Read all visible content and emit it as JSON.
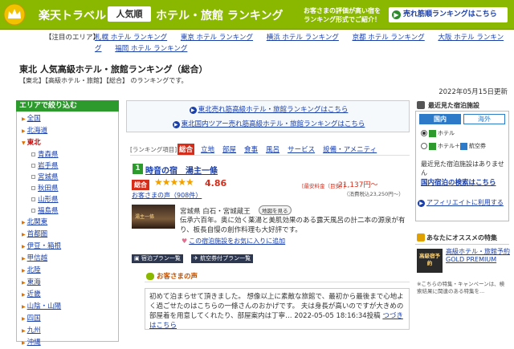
{
  "banner": {
    "title_part1": "楽天トラベル",
    "badge": "人気順",
    "title_part2": "ホテル・旅館 ランキング",
    "catch_line1": "お客さまの評価が高い宿を",
    "catch_line2": "ランキング形式でご紹介！",
    "promo_link": "売れ筋順ランキングはこちら"
  },
  "attention": {
    "label": "【注目のエリア】",
    "links": [
      "札幌 ホテル ランキング",
      "東京 ホテル ランキング",
      "横浜 ホテル ランキング",
      "京都 ホテル ランキング",
      "大阪 ホテル ランキング",
      "福岡 ホテル ランキング"
    ]
  },
  "page": {
    "title": "東北 人気高級ホテル・旅館ランキング（総合）",
    "subtitle": "【東北】【高級ホテル・旅館】【総合】 のランキングです。",
    "updated": "2022年05月15日更新"
  },
  "sidebar": {
    "heading": "エリアで絞り込む",
    "all": "全国",
    "hokkaido": "北海道",
    "current": "東北",
    "prefectures": [
      "青森県",
      "岩手県",
      "宮城県",
      "秋田県",
      "山形県",
      "福島県"
    ],
    "regions": [
      "北関東",
      "首都圏",
      "伊豆・箱根",
      "甲信越",
      "北陸",
      "東海",
      "近畿",
      "山陰・山陽",
      "四国",
      "九州",
      "沖縄"
    ]
  },
  "ranking_links": {
    "line1": "東北売れ筋高級ホテル・旅館ランキングはこちら",
    "line2": "東北国内ツアー売れ筋高級ホテル・旅館ランキングはこちら"
  },
  "tabs": {
    "label": "[ランキング項目]",
    "items": [
      "総合",
      "立地",
      "部屋",
      "食事",
      "風呂",
      "サービス",
      "設備・アメニティ"
    ]
  },
  "hotel": {
    "rank": "1",
    "name": "時音の宿　湯主一條",
    "score_label": "総合",
    "stars": "★★★★★",
    "score": "4.86",
    "reviews": "お客さまの声（908件）",
    "price_label": "[最安料金（目安）]",
    "price": "21,137円〜",
    "price_tax": "（消費税込23,250円〜）",
    "image_label": "湯主一條",
    "area": "宮城県 白石・宮城蔵王",
    "map_button": "地図を見る",
    "description": "伝承六百年。奥に効く薬湯と美肌効果のある露天風呂の計二本の源泉が有り、板長自慢の創作料理も大好評です。",
    "favorite": "この宿泊施設をお気に入りに追加",
    "plan_button": "宿泊プラン一覧",
    "tour_button": "航空券付プラン一覧"
  },
  "voice": {
    "heading": "お客さまの声",
    "text": "初めて泊まらせて頂きました。 想像以上に素敵な旅館で、最初から最後まで心地よく過ごせたのはこちらの一條さんのおかげです。 夫は身長が高いのですが大きめの部屋着を用意してくれたり、部屋案内は丁寧… 2022-05-05 18:16:34投稿",
    "more": "つづきはこちら"
  },
  "recent": {
    "heading": "最近見た宿泊施設",
    "tab_domestic": "国内",
    "tab_overseas": "海外",
    "option_hotel": "ホテル",
    "option_combo": "ホテル＋",
    "option_air": "航空券",
    "none": "最近見た宿泊施設はありません",
    "search": "国内宿泊の検索はこちら",
    "affiliate": "アフィリエイトに利用する"
  },
  "recommend": {
    "heading": "あなたにオススメの特集",
    "image_text": "高級宿予約",
    "link": "高級ホテル・旅館予約 GOLD PREMIUM",
    "note": "※こちらの特集・キャンペーンは、検索結果に関連のある特集を..."
  }
}
